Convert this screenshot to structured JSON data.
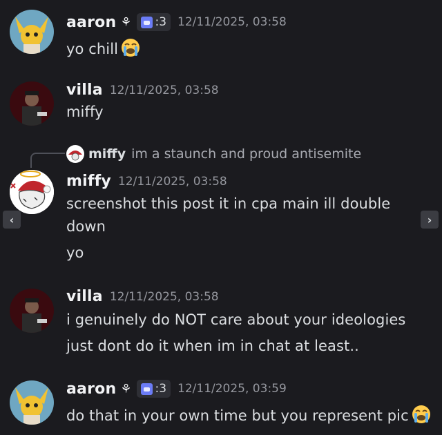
{
  "messages": [
    {
      "username": "aaron",
      "tag": ":3",
      "timestamp": "12/11/2025, 03:58",
      "lines": [
        "yo chill"
      ],
      "trailing_emoji": "loudly-crying-face"
    },
    {
      "username": "villa",
      "timestamp": "12/11/2025, 03:58",
      "lines": [
        "miffy"
      ]
    },
    {
      "reply": {
        "username": "miffy",
        "text": "im a staunch and proud antisemite"
      },
      "username": "miffy",
      "timestamp": "12/11/2025, 03:58",
      "lines": [
        "screenshot this post it in cpa main ill double",
        "down",
        "yo"
      ]
    },
    {
      "username": "villa",
      "timestamp": "12/11/2025, 03:58",
      "lines": [
        "i genuinely do NOT care about your ideologies",
        "just dont do it when im in chat at least.."
      ]
    },
    {
      "username": "aaron",
      "tag": ":3",
      "timestamp": "12/11/2025, 03:59",
      "lines": [
        "do that in your own time but you represent pic"
      ],
      "trailing_emoji": "loudly-crying-face"
    }
  ],
  "nav": {
    "prev": "‹",
    "next": "›"
  },
  "colors": {
    "background": "#1b1b1f",
    "username": "#f2f3f5",
    "message_text": "#dbdee1",
    "timestamp": "#95979e",
    "tag_background": "#2e2f35",
    "tag_icon": "#6b7cf6"
  },
  "icons": {
    "sprout": "sprout-icon",
    "tag_icon": "cat-icon",
    "emoji": "loudly-crying-face-emoji"
  }
}
